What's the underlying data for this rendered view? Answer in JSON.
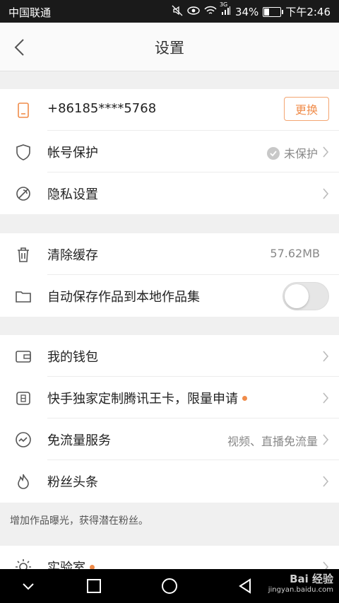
{
  "status": {
    "carrier": "中国联通",
    "network": "3G",
    "battery": "34%",
    "battery_level": 0.34,
    "time": "下午2:46"
  },
  "header": {
    "title": "设置",
    "back_icon": "chevron-left-icon"
  },
  "account": {
    "phone": "+86185****5768",
    "change_label": "更换",
    "protect_label": "帐号保护",
    "protect_status": "未保护",
    "privacy_label": "隐私设置"
  },
  "storage": {
    "clear_cache_label": "清除缓存",
    "cache_size": "57.62MB",
    "autosave_label": "自动保存作品到本地作品集",
    "autosave_on": false
  },
  "services": {
    "wallet_label": "我的钱包",
    "kingcard_label": "快手独家定制腾讯王卡，限量申请",
    "freeflow_label": "免流量服务",
    "freeflow_value": "视频、直播免流量",
    "fans_label": "粉丝头条",
    "fans_hint": "增加作品曝光，获得潜在粉丝。"
  },
  "lab": {
    "label": "实验室"
  },
  "watermark": {
    "brand": "Bai 经验",
    "url": "jingyan.baidu.com"
  },
  "colors": {
    "accent": "#f08c4a",
    "divider": "#ececec",
    "background": "#f0f0f0"
  }
}
